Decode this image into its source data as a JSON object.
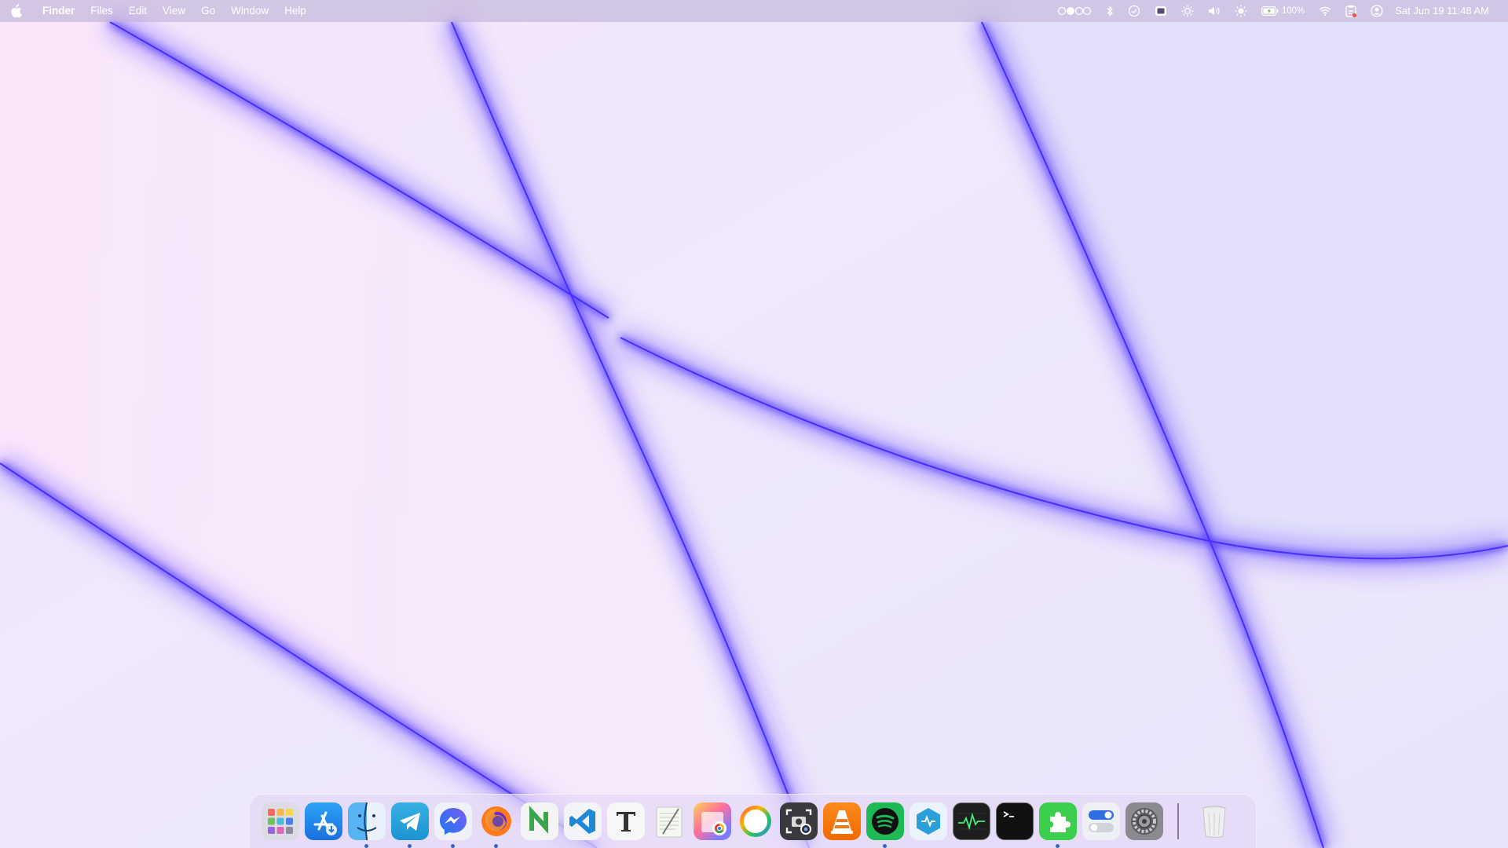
{
  "menubar": {
    "app_name": "Finder",
    "menus": [
      "Files",
      "Edit",
      "View",
      "Go",
      "Window",
      "Help"
    ],
    "status_icons": [
      "input-source-icon",
      "bluetooth-icon",
      "check-circle-icon",
      "display-icon",
      "brightness-icon",
      "volume-icon",
      "sun-icon",
      "battery-icon",
      "wifi-icon",
      "clipboard-icon",
      "user-icon"
    ],
    "battery_percent": "100%",
    "datetime": "Sat Jun 19  11:48 AM"
  },
  "dock": {
    "apps": [
      {
        "name": "launchpad-icon",
        "running": false
      },
      {
        "name": "app-store-icon",
        "running": false
      },
      {
        "name": "finder-icon",
        "running": true
      },
      {
        "name": "telegram-icon",
        "running": true
      },
      {
        "name": "messenger-icon",
        "running": true
      },
      {
        "name": "firefox-icon",
        "running": true
      },
      {
        "name": "notion-n-icon",
        "running": false
      },
      {
        "name": "vscode-icon",
        "running": false
      },
      {
        "name": "typora-icon",
        "running": false
      },
      {
        "name": "textedit-icon",
        "running": false
      },
      {
        "name": "photos-chrome-icon",
        "running": false
      },
      {
        "name": "ring-app-icon",
        "running": false
      },
      {
        "name": "screenshot-icon",
        "running": false
      },
      {
        "name": "vlc-icon",
        "running": false
      },
      {
        "name": "spotify-icon",
        "running": true
      },
      {
        "name": "hex-app-icon",
        "running": false
      },
      {
        "name": "activity-monitor-icon",
        "running": false
      },
      {
        "name": "terminal-icon",
        "running": false
      },
      {
        "name": "puzzle-app-icon",
        "running": true
      },
      {
        "name": "toggle-settings-icon",
        "running": false
      },
      {
        "name": "system-preferences-icon",
        "running": false
      }
    ],
    "trash": {
      "name": "trash-icon"
    }
  },
  "colors": {
    "wallpaper_base": "#ece6fb",
    "wallpaper_line": "#3a22ff",
    "menubar": "#bdb2d6",
    "dock": "#e4d8f6"
  }
}
